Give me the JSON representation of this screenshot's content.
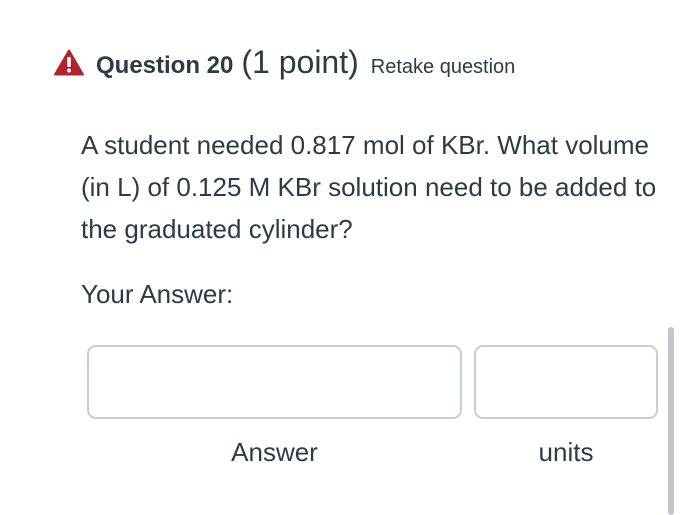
{
  "header": {
    "warning_icon": "warning-triangle-icon",
    "warning_color": "#b2232b",
    "title": "Question 20",
    "points": "(1 point)",
    "retake_label": "Retake question"
  },
  "question": {
    "text": "A student needed 0.817 mol of KBr.  What volume (in L) of 0.125 M KBr solution need to be added to the graduated cylinder?"
  },
  "answer_section": {
    "heading": "Your Answer:",
    "fields": [
      {
        "label": "Answer",
        "value": ""
      },
      {
        "label": "units",
        "value": ""
      }
    ]
  }
}
